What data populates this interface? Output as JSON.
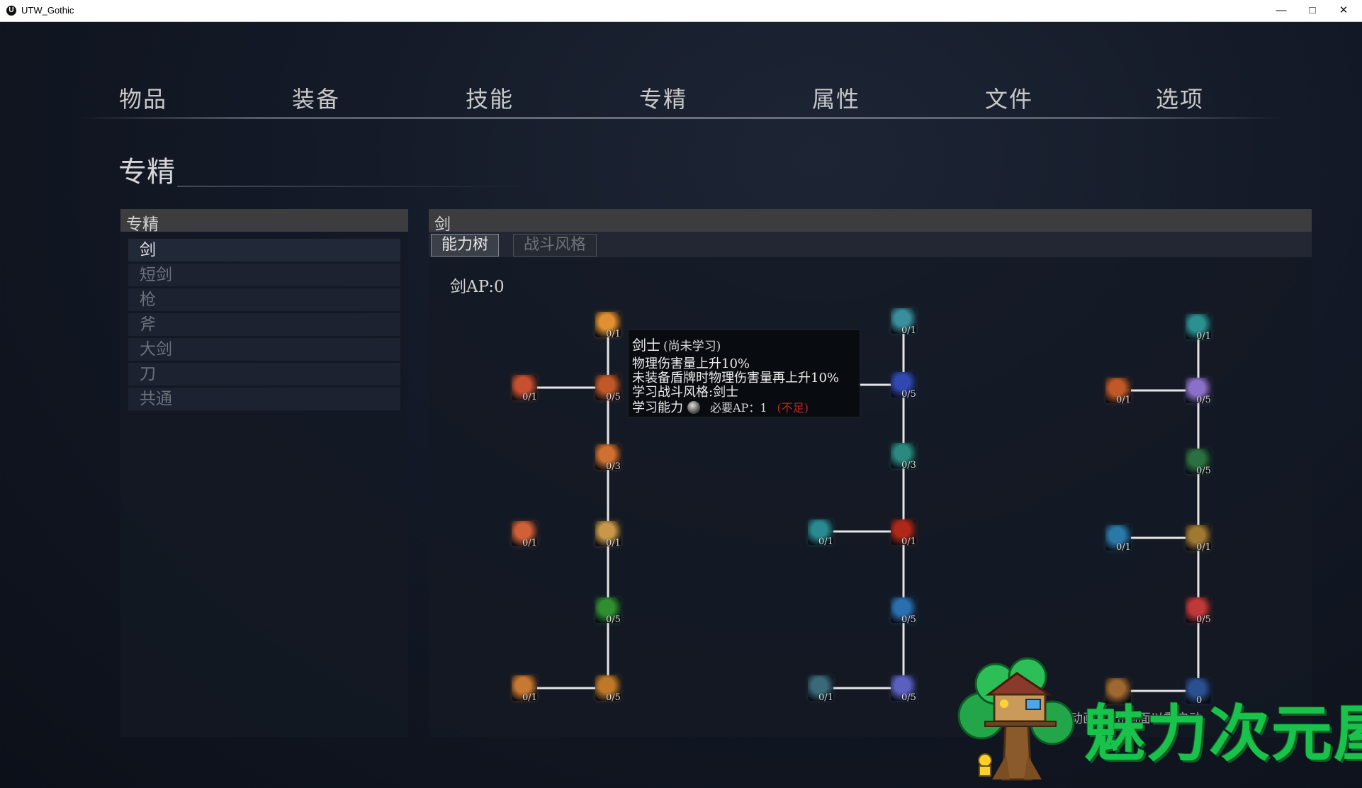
{
  "window": {
    "title": "UTW_Gothic",
    "icon": "unreal-logo-icon",
    "controls": [
      "minimize",
      "maximize",
      "close"
    ]
  },
  "nav": {
    "tabs": [
      "物品",
      "装备",
      "技能",
      "专精",
      "属性",
      "文件",
      "选项"
    ]
  },
  "page_title": "专精",
  "left_panel": {
    "header": "专精",
    "items": [
      "剑",
      "短剑",
      "枪",
      "斧",
      "大剑",
      "刀",
      "共通"
    ],
    "active_index": 0
  },
  "right_panel": {
    "header": "剑",
    "subtabs": [
      "能力树",
      "战斗风格"
    ],
    "active_subtab": 0,
    "ap_label": "剑AP:0"
  },
  "tree": {
    "nodes": [
      {
        "id": "a1",
        "count": "0/1",
        "color": "#e09030"
      },
      {
        "id": "a2",
        "count": "0/1",
        "color": "#c85030"
      },
      {
        "id": "a3",
        "count": "0/5",
        "color": "#c05828"
      },
      {
        "id": "a4",
        "count": "0/3",
        "color": "#d07030"
      },
      {
        "id": "a5",
        "count": "0/1",
        "color": "#d06038"
      },
      {
        "id": "a6",
        "count": "0/1",
        "color": "#c89848"
      },
      {
        "id": "a7",
        "count": "0/5",
        "color": "#2f8f2f"
      },
      {
        "id": "a8",
        "count": "0/1",
        "color": "#c87830"
      },
      {
        "id": "a9",
        "count": "0/5",
        "color": "#c07828"
      },
      {
        "id": "b1",
        "count": "0/1",
        "color": "#3a8e9e"
      },
      {
        "id": "b2",
        "count": "0/5",
        "color": "#3048b0"
      },
      {
        "id": "b3",
        "count": "0/3",
        "color": "#2a8a80"
      },
      {
        "id": "b4",
        "count": "0/1",
        "color": "#2a8a90"
      },
      {
        "id": "b5",
        "count": "0/1",
        "color": "#b02818"
      },
      {
        "id": "b6",
        "count": "0/5",
        "color": "#2a70b0"
      },
      {
        "id": "b7",
        "count": "0/1",
        "color": "#3a6a7a"
      },
      {
        "id": "b8",
        "count": "0/5",
        "color": "#5a60c0"
      },
      {
        "id": "c1",
        "count": "0/1",
        "color": "#2a9090"
      },
      {
        "id": "c2",
        "count": "0/1",
        "color": "#c05828"
      },
      {
        "id": "c3",
        "count": "0/5",
        "color": "#8a70c8"
      },
      {
        "id": "c4",
        "count": "0/5",
        "color": "#2a7040"
      },
      {
        "id": "c5",
        "count": "0/1",
        "color": "#2a78a8"
      },
      {
        "id": "c6",
        "count": "0/1",
        "color": "#a07830"
      },
      {
        "id": "c7",
        "count": "0/5",
        "color": "#c03838"
      },
      {
        "id": "c8",
        "count": "",
        "color": "#a06830"
      },
      {
        "id": "c9",
        "count": "0",
        "color": "#2a5090"
      }
    ]
  },
  "tooltip": {
    "name": "剑士",
    "status": "(尚未学习)",
    "lines": [
      "物理伤害量上升10%",
      "未装备盾牌时物理伤害量再上升10%",
      "学习战斗风格:剑士"
    ],
    "learn_label": "学习能力",
    "required": "必要AP：1",
    "insufficient": "(不足)"
  },
  "hint": "动画        点击画面以重启动",
  "watermark": {
    "text": "魅力次元屋",
    "color": "#19c24b"
  }
}
